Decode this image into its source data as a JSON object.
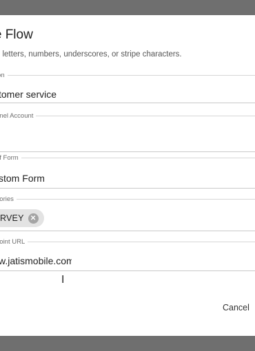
{
  "dialog": {
    "title": "ate Flow",
    "hint": "case letters, numbers, underscores, or stripe characters."
  },
  "fields": {
    "description": {
      "label": "ion",
      "value": "tomer service"
    },
    "channel_account": {
      "label": "nnel Account",
      "value": ""
    },
    "type_of_form": {
      "label": "of Form",
      "value": "stom Form"
    },
    "categories": {
      "label": "gories",
      "chip": "RVEY"
    },
    "endpoint_url": {
      "label": "point URL",
      "value": "w.jatismobile.com/\\"
    }
  },
  "actions": {
    "cancel_label": "Cancel"
  },
  "icons": {
    "chip_remove": "close-circle-icon",
    "cursor": "text-cursor-icon"
  },
  "colors": {
    "focus": "#3b8fd6",
    "overlay": "#6b6b6b"
  }
}
